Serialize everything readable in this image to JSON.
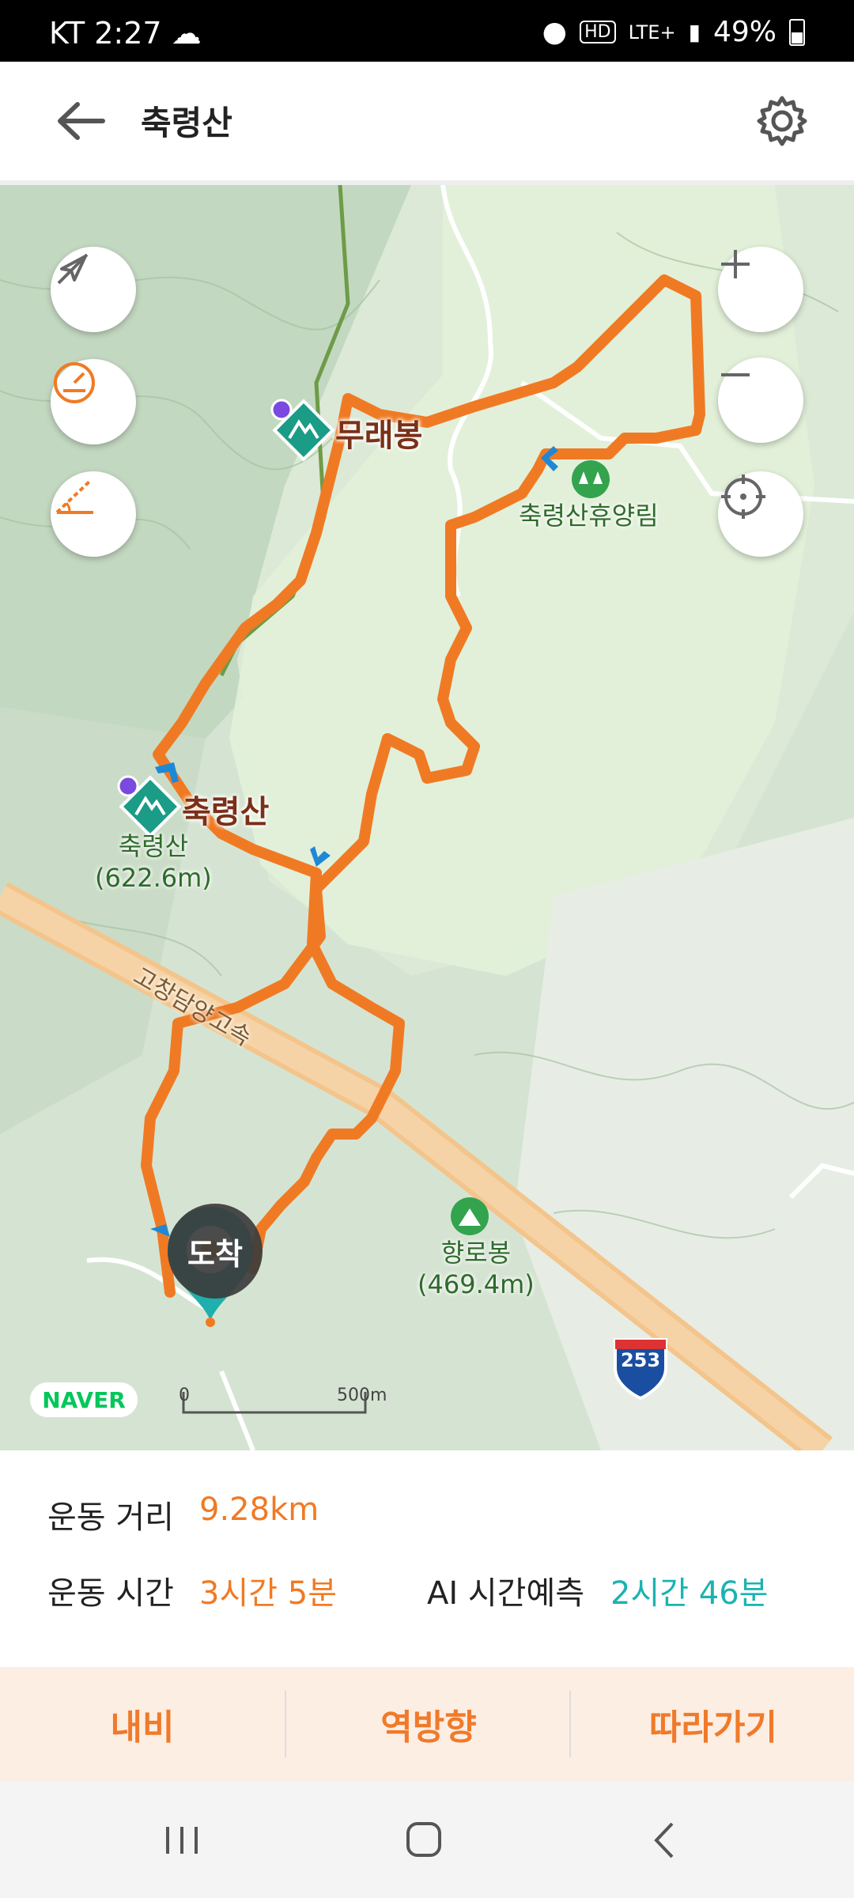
{
  "status_bar": {
    "carrier_time": "KT 2:27",
    "network": "LTE+",
    "battery": "49%"
  },
  "header": {
    "title": "축령산"
  },
  "map": {
    "peak_main": "축령산",
    "peak_main_sub_name": "축령산",
    "peak_main_sub_height": "(622.6m)",
    "peak_muraebong": "무래봉",
    "forest": "축령산휴양림",
    "highway": "고창담양고속",
    "peak_hyangro": "향로봉",
    "peak_hyangro_height": "(469.4m)",
    "route_no": "253",
    "arrival": "도착",
    "brand": "NAVER",
    "scale_zero": "0",
    "scale_label": "500m",
    "route_color": "#f07a24"
  },
  "panel": {
    "distance_label": "운동 거리",
    "distance_value": "9.28km",
    "time_label": "운동 시간",
    "time_value": "3시간 5분",
    "ai_label": "AI 시간예측",
    "ai_value": "2시간 46분"
  },
  "actions": {
    "navi": "내비",
    "reverse": "역방향",
    "follow": "따라가기"
  }
}
